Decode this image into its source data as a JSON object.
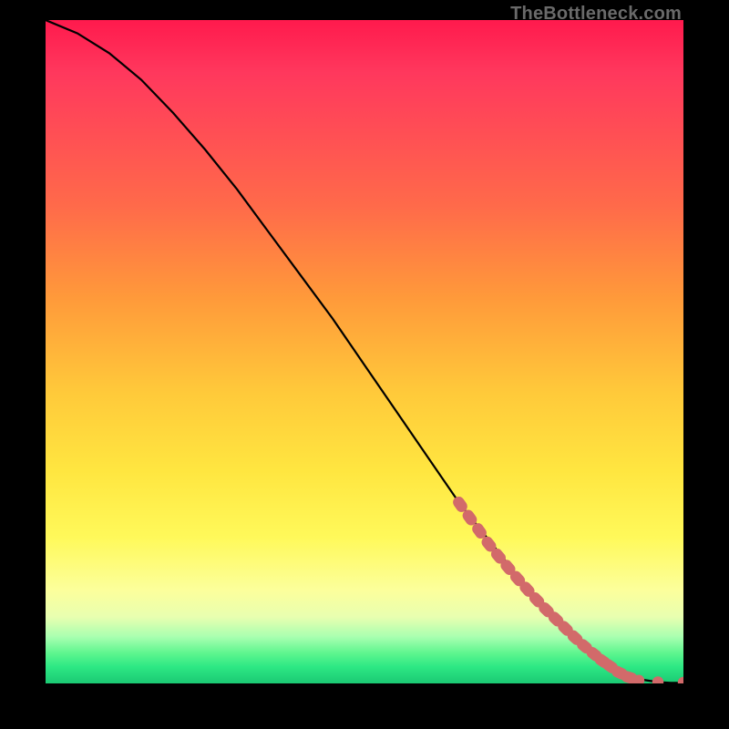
{
  "watermark": "TheBottleneck.com",
  "chart_data": {
    "type": "line",
    "title": "",
    "xlabel": "",
    "ylabel": "",
    "xlim": [
      0,
      100
    ],
    "ylim": [
      0,
      100
    ],
    "series": [
      {
        "name": "curve",
        "x": [
          0,
          5,
          10,
          15,
          20,
          25,
          30,
          35,
          40,
          45,
          50,
          55,
          60,
          65,
          70,
          75,
          80,
          82,
          84,
          86,
          88,
          90,
          92,
          94,
          96,
          98,
          100
        ],
        "y": [
          100,
          98,
          95,
          91,
          86,
          80.5,
          74.5,
          68,
          61.5,
          55,
          48,
          41,
          34,
          27,
          21,
          15,
          10,
          8,
          6,
          4.3,
          3.0,
          1.8,
          1.0,
          0.5,
          0.2,
          0.1,
          0.1
        ]
      }
    ],
    "markers": {
      "name": "highlighted-points",
      "note": "dense cluster on lower-right tail of curve",
      "points": [
        {
          "x": 65,
          "y": 27
        },
        {
          "x": 66.5,
          "y": 25
        },
        {
          "x": 68,
          "y": 23
        },
        {
          "x": 69.5,
          "y": 21
        },
        {
          "x": 71,
          "y": 19.2
        },
        {
          "x": 72.5,
          "y": 17.5
        },
        {
          "x": 74,
          "y": 15.8
        },
        {
          "x": 75.5,
          "y": 14.2
        },
        {
          "x": 77,
          "y": 12.6
        },
        {
          "x": 78.5,
          "y": 11.1
        },
        {
          "x": 80,
          "y": 9.7
        },
        {
          "x": 81.5,
          "y": 8.3
        },
        {
          "x": 83,
          "y": 6.9
        },
        {
          "x": 84.5,
          "y": 5.6
        },
        {
          "x": 86,
          "y": 4.4
        },
        {
          "x": 87.3,
          "y": 3.4
        },
        {
          "x": 88.5,
          "y": 2.6
        },
        {
          "x": 90,
          "y": 1.6
        },
        {
          "x": 91.5,
          "y": 0.9
        },
        {
          "x": 93,
          "y": 0.45
        },
        {
          "x": 96,
          "y": 0.2
        },
        {
          "x": 100,
          "y": 0.15
        }
      ]
    }
  }
}
